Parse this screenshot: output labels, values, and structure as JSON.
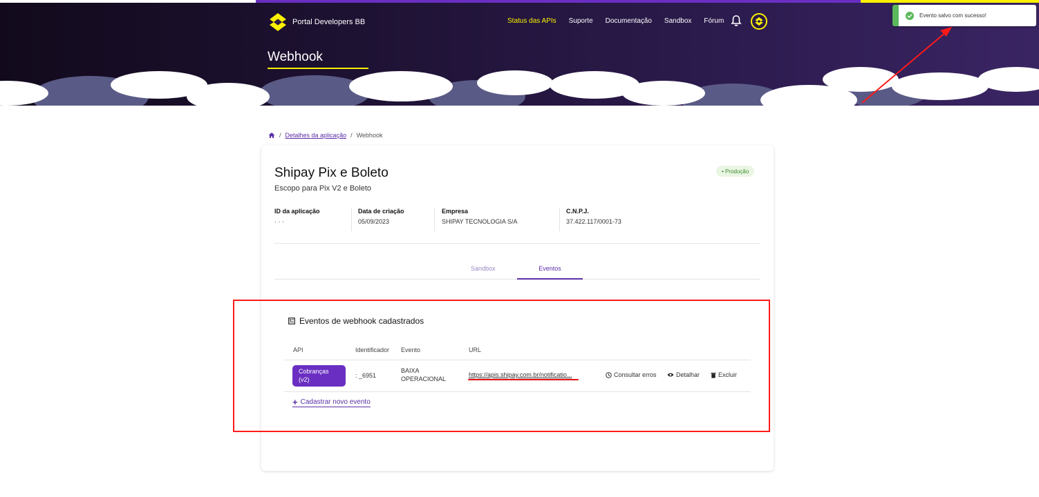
{
  "header": {
    "logo_text": "Portal Developers BB",
    "nav": [
      "Status das APIs",
      "Suporte",
      "Documentação",
      "Sandbox",
      "Fórum"
    ],
    "page_title": "Webhook",
    "accent_color": "#fcf000"
  },
  "toast": {
    "message": "Evento salvo com sucesso!",
    "status_color": "#5cb85c"
  },
  "breadcrumb": {
    "home_icon": "home-icon",
    "link": "Detalhes da aplicação",
    "current": "Webhook"
  },
  "app": {
    "name": "Shipay Pix e Boleto",
    "scope": "Escopo para Pix V2 e Boleto",
    "environment_badge": "• Produção",
    "info": {
      "id_label": "ID da aplicação",
      "id_value": "· · ·",
      "date_label": "Data de criação",
      "date_value": "05/09/2023",
      "company_label": "Empresa",
      "company_value": "SHIPAY TECNOLOGIA S/A",
      "cnpj_label": "C.N.P.J.",
      "cnpj_value": "37.422.117/0001-73"
    }
  },
  "tabs": {
    "sandbox": "Sandbox",
    "eventos": "Eventos"
  },
  "events": {
    "title": "Eventos de webhook cadastrados",
    "columns": {
      "api": "API",
      "identifier": "Identificador",
      "event": "Evento",
      "url": "URL"
    },
    "row": {
      "api_line1": "Cobranças",
      "api_line2": "(v2)",
      "identifier": ": _6951",
      "event_line1": "BAIXA",
      "event_line2": "OPERACIONAL",
      "url": "https://apis.shipay.com.br/notificatio...",
      "actions": {
        "errors": "Consultar erros",
        "detail": "Detalhar",
        "delete": "Excluir"
      }
    },
    "add_label": "Cadastrar novo evento"
  },
  "annotation_color": "#ff1a1a"
}
